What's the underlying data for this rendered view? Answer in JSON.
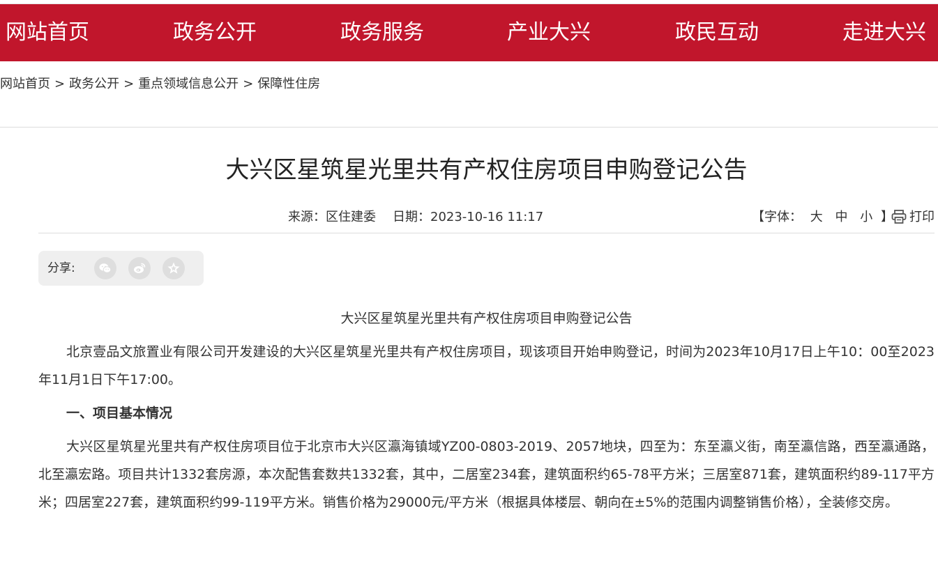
{
  "nav": {
    "items": [
      "网站首页",
      "政务公开",
      "政务服务",
      "产业大兴",
      "政民互动",
      "走进大兴"
    ]
  },
  "breadcrumb": {
    "items": [
      "网站首页",
      "政务公开",
      "重点领域信息公开",
      "保障性住房"
    ],
    "separator": ">"
  },
  "article": {
    "title": "大兴区星筑星光里共有产权住房项目申购登记公告",
    "source": "来源：区住建委",
    "date": "日期：2023-10-16 11:17",
    "font_size": {
      "open": "【字体：",
      "large": "大",
      "medium": "中",
      "small": "小",
      "close": "】"
    },
    "print_label": "打印",
    "share_label": "分享:",
    "share_icons": [
      "wechat-icon",
      "weibo-icon",
      "favorite-icon"
    ],
    "body_title": "大兴区星筑星光里共有产权住房项目申购登记公告",
    "para1": "北京壹品文旅置业有限公司开发建设的大兴区星筑星光里共有产权住房项目，现该项目开始申购登记，时间为2023年10月17日上午10：00至2023年11月1日下午17:00。",
    "section1_heading": "一、项目基本情况",
    "para2": "大兴区星筑星光里共有产权住房项目位于北京市大兴区瀛海镇域YZ00-0803-2019、2057地块，四至为：东至瀛义街，南至瀛信路，西至瀛通路，北至瀛宏路。项目共计1332套房源，本次配售套数共1332套，其中，二居室234套，建筑面积约65-78平方米；三居室871套，建筑面积约89-117平方米；四居室227套，建筑面积约99-119平方米。销售价格为29000元/平方米（根据具体楼层、朝向在±5%的范围内调整销售价格），全装修交房。"
  },
  "colors": {
    "nav_bg": "#c1162c",
    "nav_text": "#ffffff",
    "share_bg": "#efefef"
  }
}
